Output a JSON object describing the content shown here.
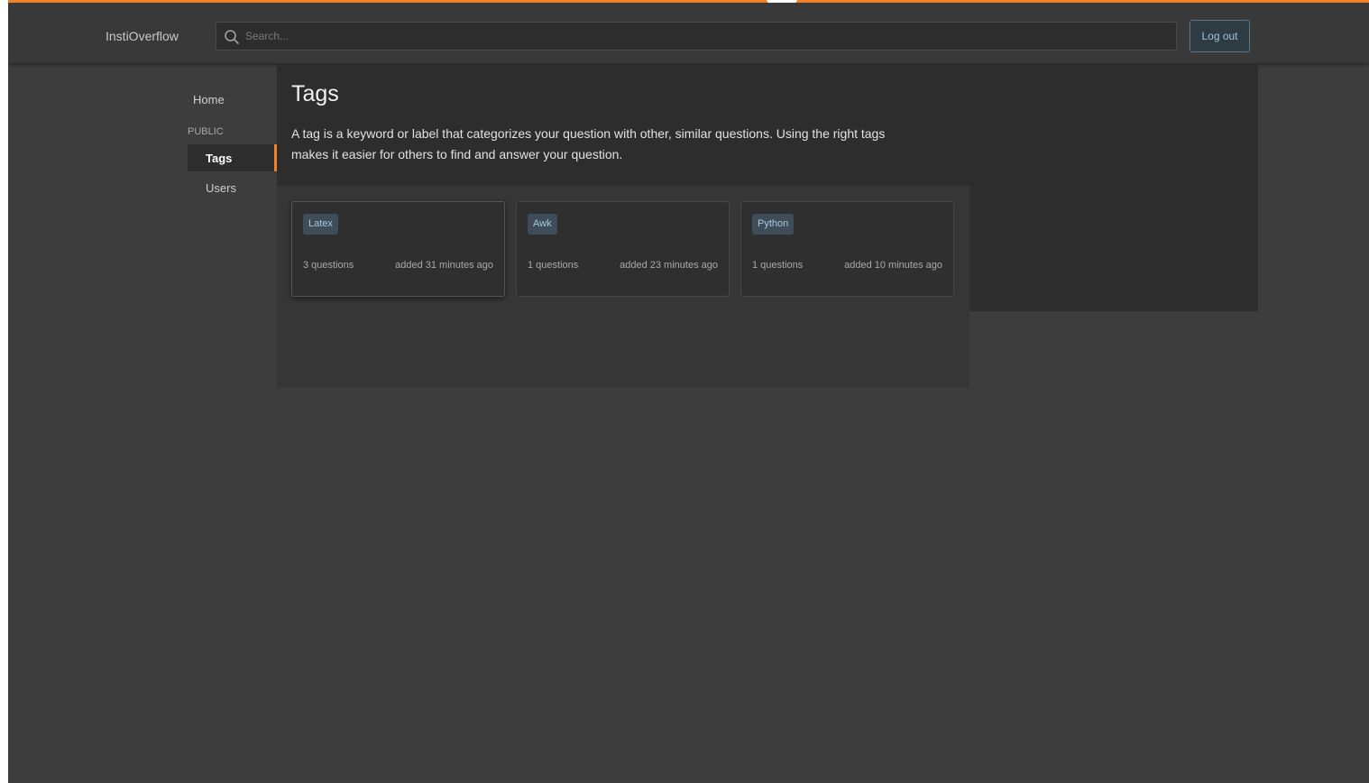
{
  "app": {
    "name": "InstiOverflow",
    "accent_color": "#f48024"
  },
  "header": {
    "search_placeholder": "Search...",
    "search_icon": "search-icon",
    "logout_label": "Log out"
  },
  "sidebar": {
    "home_label": "Home",
    "section_label": "PUBLIC",
    "items": [
      {
        "label": "Tags",
        "active": true
      },
      {
        "label": "Users",
        "active": false
      }
    ]
  },
  "main": {
    "title": "Tags",
    "description": "A tag is a keyword or label that categorizes your question with other, similar questions. Using the right tags makes it easier for others to find and answer your question."
  },
  "tags": [
    {
      "name": "Latex",
      "count": "3 questions",
      "added": "added 31 minutes ago"
    },
    {
      "name": "Awk",
      "count": "1 questions",
      "added": "added 23 minutes ago"
    },
    {
      "name": "Python",
      "count": "1 questions",
      "added": "added 10 minutes ago"
    }
  ]
}
